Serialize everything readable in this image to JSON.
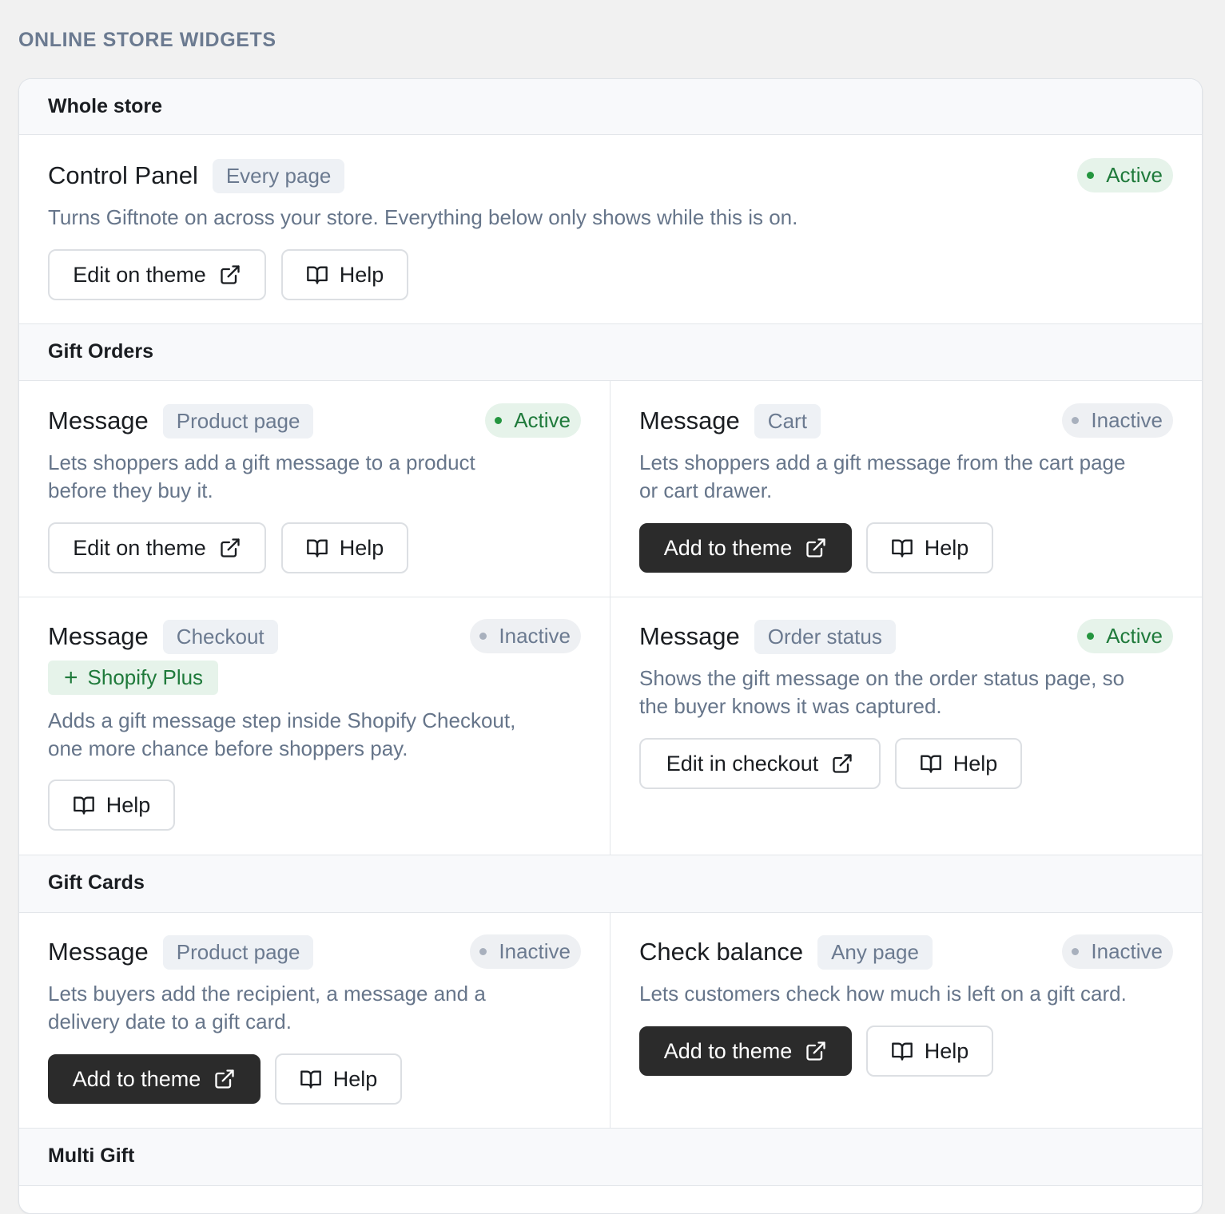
{
  "page_heading": "ONLINE STORE WIDGETS",
  "sections": {
    "whole_store": {
      "title": "Whole store",
      "control_panel": {
        "title": "Control Panel",
        "scope": "Every page",
        "status": "Active",
        "description": "Turns Giftnote on across your store. Everything below only shows while this is on.",
        "primary_label": "Edit on theme",
        "help_label": "Help"
      }
    },
    "gift_orders": {
      "title": "Gift Orders",
      "product_message": {
        "title": "Message",
        "scope": "Product page",
        "status": "Active",
        "description_line1": "Lets shoppers add a gift message to a product",
        "description_line2": "before they buy it.",
        "primary_label": "Edit on theme",
        "help_label": "Help"
      },
      "cart_message": {
        "title": "Message",
        "scope": "Cart",
        "status": "Inactive",
        "description_line1": "Lets shoppers add a gift message from the cart page",
        "description_line2": "or cart drawer.",
        "primary_label": "Add to theme",
        "help_label": "Help"
      },
      "checkout_message": {
        "title": "Message",
        "scope": "Checkout",
        "status": "Inactive",
        "plan_badge": "Shopify Plus",
        "description_line1": "Adds a gift message step inside Shopify Checkout,",
        "description_line2": "one more chance before shoppers pay.",
        "help_label": "Help"
      },
      "order_status_message": {
        "title": "Message",
        "scope": "Order status",
        "status": "Active",
        "description_line1": "Shows the gift message on the order status page, so",
        "description_line2": "the buyer knows it was captured.",
        "primary_label": "Edit in checkout",
        "help_label": "Help"
      }
    },
    "gift_cards": {
      "title": "Gift Cards",
      "card_message": {
        "title": "Message",
        "scope": "Product page",
        "status": "Inactive",
        "description_line1": "Lets buyers add the recipient, a message and a",
        "description_line2": "delivery date to a gift card.",
        "primary_label": "Add to theme",
        "help_label": "Help"
      },
      "check_balance": {
        "title": "Check balance",
        "scope": "Any page",
        "status": "Inactive",
        "description": "Lets customers check how much is left on a gift card.",
        "primary_label": "Add to theme",
        "help_label": "Help"
      }
    },
    "multi_gift": {
      "title": "Multi Gift"
    }
  },
  "colors": {
    "active_text": "#1f7a3b",
    "active_bg": "#e6f3ea",
    "inactive_text": "#6b7a90",
    "dark_button": "#2b2b2b"
  },
  "icons": {
    "external": "external-link-icon",
    "help": "book-icon",
    "plus": "plus-icon"
  }
}
